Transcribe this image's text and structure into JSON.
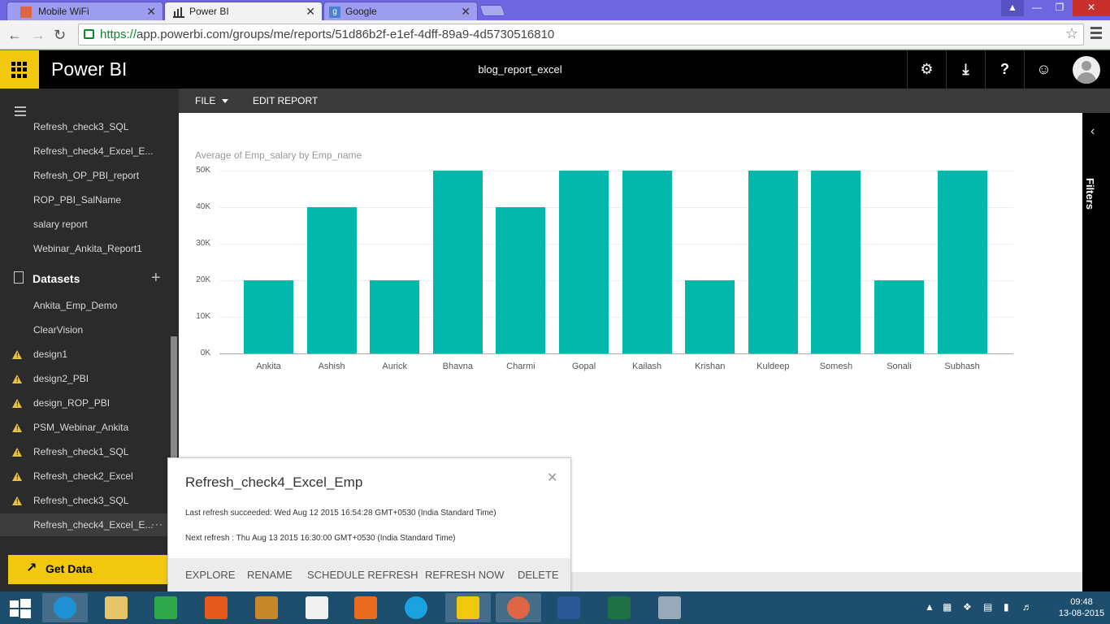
{
  "browser": {
    "tabs": [
      {
        "label": "Mobile WiFi",
        "active": false
      },
      {
        "label": "Power BI",
        "active": true
      },
      {
        "label": "Google",
        "active": false
      }
    ],
    "url_scheme": "https://",
    "url_rest": "app.powerbi.com/groups/me/reports/51d86b2f-e1ef-4dff-89a9-4d5730516810",
    "close_glyph": "✕"
  },
  "header": {
    "brand": "Power BI",
    "report_title": "blog_report_excel",
    "icons": [
      "gear-icon",
      "download-icon",
      "help-icon",
      "smiley-icon",
      "user-avatar"
    ]
  },
  "sidebar": {
    "report_items": [
      "Refresh_check3_SQL",
      "Refresh_check4_Excel_E...",
      "Refresh_OP_PBI_report",
      "ROP_PBI_SalName",
      "salary report",
      "Webinar_Ankita_Report1"
    ],
    "datasets_label": "Datasets",
    "dataset_items": [
      {
        "label": "Ankita_Emp_Demo",
        "warning": false
      },
      {
        "label": "ClearVision",
        "warning": false
      },
      {
        "label": "design1",
        "warning": true
      },
      {
        "label": "design2_PBI",
        "warning": true
      },
      {
        "label": "design_ROP_PBI",
        "warning": true
      },
      {
        "label": "PSM_Webinar_Ankita",
        "warning": true
      },
      {
        "label": "Refresh_check1_SQL",
        "warning": true
      },
      {
        "label": "Refresh_check2_Excel",
        "warning": true
      },
      {
        "label": "Refresh_check3_SQL",
        "warning": true
      },
      {
        "label": "Refresh_check4_Excel_E...",
        "warning": false,
        "selected": true
      }
    ],
    "ellipsis": "···",
    "get_data": "Get Data"
  },
  "report_bar": {
    "file": "FILE",
    "edit": "EDIT REPORT"
  },
  "filters_label": "Filters",
  "chart_data": {
    "type": "bar",
    "title": "Average of Emp_salary by Emp_name",
    "categories": [
      "Ankita",
      "Ashish",
      "Aurick",
      "Bhavna",
      "Charmi",
      "Gopal",
      "Kailash",
      "Krishan",
      "Kuldeep",
      "Somesh",
      "Sonali",
      "Subhash"
    ],
    "values": [
      20000,
      40000,
      20000,
      50000,
      40000,
      50000,
      50000,
      20000,
      50000,
      50000,
      20000,
      50000
    ],
    "yticks": [
      "0K",
      "10K",
      "20K",
      "30K",
      "40K",
      "50K"
    ],
    "ylim": [
      0,
      50000
    ],
    "color": "#01b8aa",
    "grid": true
  },
  "popup": {
    "title": "Refresh_check4_Excel_Emp",
    "last_refresh": "Last refresh succeeded: Wed Aug 12 2015 16:54:28 GMT+0530 (India Standard Time)",
    "next_refresh": "Next refresh : Thu Aug 13 2015 16:30:00 GMT+0530 (India Standard Time)",
    "actions": [
      "EXPLORE",
      "RENAME",
      "SCHEDULE REFRESH",
      "REFRESH NOW",
      "DELETE"
    ]
  },
  "taskbar": {
    "apps": [
      "start",
      "internet-explorer",
      "file-explorer",
      "store",
      "photos",
      "notes",
      "home",
      "media-player",
      "skype",
      "power-bi",
      "chrome",
      "word",
      "excel",
      "paint"
    ],
    "time": "09:48",
    "date": "13-08-2015"
  }
}
